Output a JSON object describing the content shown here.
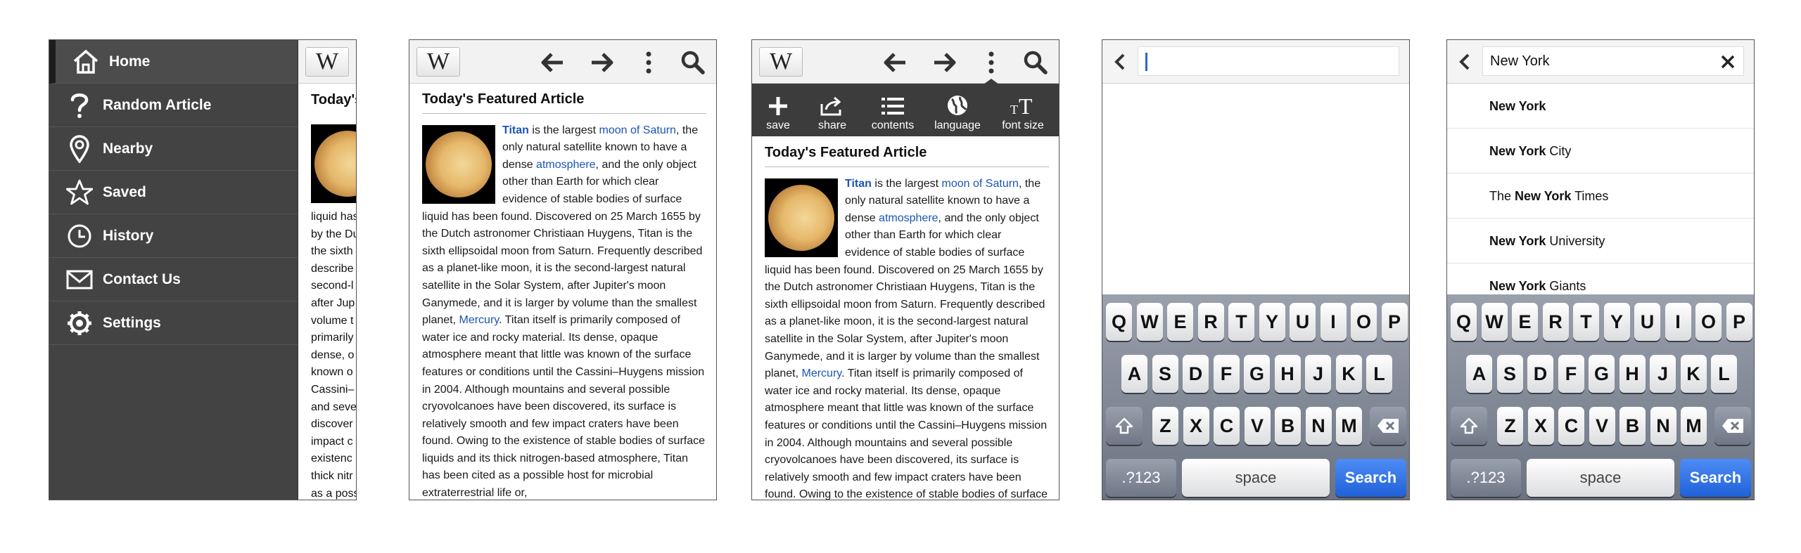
{
  "menu": {
    "items": [
      {
        "label": "Home",
        "icon": "home-icon"
      },
      {
        "label": "Random Article",
        "icon": "question-icon"
      },
      {
        "label": "Nearby",
        "icon": "location-pin-icon"
      },
      {
        "label": "Saved",
        "icon": "star-icon"
      },
      {
        "label": "History",
        "icon": "clock-icon"
      },
      {
        "label": "Contact Us",
        "icon": "envelope-icon"
      },
      {
        "label": "Settings",
        "icon": "gear-icon"
      }
    ]
  },
  "logo": "W",
  "peek": {
    "title": "Today's",
    "lines": [
      "liquid has",
      "by the Du",
      "the sixth",
      "describe",
      "second-l",
      "after Jup",
      "volume t",
      "primarily",
      "dense, o",
      "known o",
      "Cassini–",
      "and seve",
      "discover",
      "impact c",
      "existenc",
      "thick nitr",
      "as a poss"
    ]
  },
  "article": {
    "title": "Today's Featured Article",
    "link_titan": "Titan",
    "t1": " is the largest ",
    "link_moon": "moon of Saturn",
    "t2": ", the only natural satellite known to have a dense ",
    "link_atmosphere": "atmosphere",
    "t3": ", and the only object other than Earth for which clear evidence of stable bodies of surface liquid has been found. Discovered on 25 March 1655 by the Dutch astronomer Christiaan Huygens, Titan is the sixth ellipsoidal moon from Saturn. Frequently described as a planet-like moon, it is the second-largest natural satellite in the Solar System, after Jupiter's moon Ganymede, and it is larger by volume than the smallest planet, ",
    "link_mercury": "Mercury",
    "t4": ". Titan itself is primarily composed of water ice and rocky material. Its dense, opaque atmosphere meant that little was known of the surface features or conditions until the Cassini–Huygens mission in 2004. Although mountains and several possible cryovolcanoes have been discovered, its surface is relatively smooth and few impact craters have been found. Owing to the existence of stable bodies of surface liquids and its thick nitrogen-based atmosphere, Titan has been cited as a possible host for microbial extraterrestrial life or,"
  },
  "actions": [
    {
      "label": "save",
      "icon": "plus-icon"
    },
    {
      "label": "share",
      "icon": "share-icon"
    },
    {
      "label": "contents",
      "icon": "list-icon"
    },
    {
      "label": "language",
      "icon": "globe-icon"
    },
    {
      "label": "font size",
      "icon": "font-size-icon"
    }
  ],
  "search_empty": {
    "value": ""
  },
  "search_filled": {
    "value": "New York",
    "suggestions": [
      {
        "pre": "",
        "bold": "New York",
        "post": ""
      },
      {
        "pre": "",
        "bold": "New York",
        "post": " City"
      },
      {
        "pre": "The ",
        "bold": "New York",
        "post": " Times"
      },
      {
        "pre": "",
        "bold": "New York",
        "post": " University"
      },
      {
        "pre": "",
        "bold": "New York",
        "post": " Giants"
      }
    ]
  },
  "keyboard": {
    "row1": [
      "Q",
      "W",
      "E",
      "R",
      "T",
      "Y",
      "U",
      "I",
      "O",
      "P"
    ],
    "row2": [
      "A",
      "S",
      "D",
      "F",
      "G",
      "H",
      "J",
      "K",
      "L"
    ],
    "row3": [
      "Z",
      "X",
      "C",
      "V",
      "B",
      "N",
      "M"
    ],
    "numbers_label": ".?123",
    "space_label": "space",
    "search_label": "Search"
  },
  "colors": {
    "link": "#1a55b5",
    "search_key": "#1f61d8",
    "menu_bg": "#434343"
  }
}
